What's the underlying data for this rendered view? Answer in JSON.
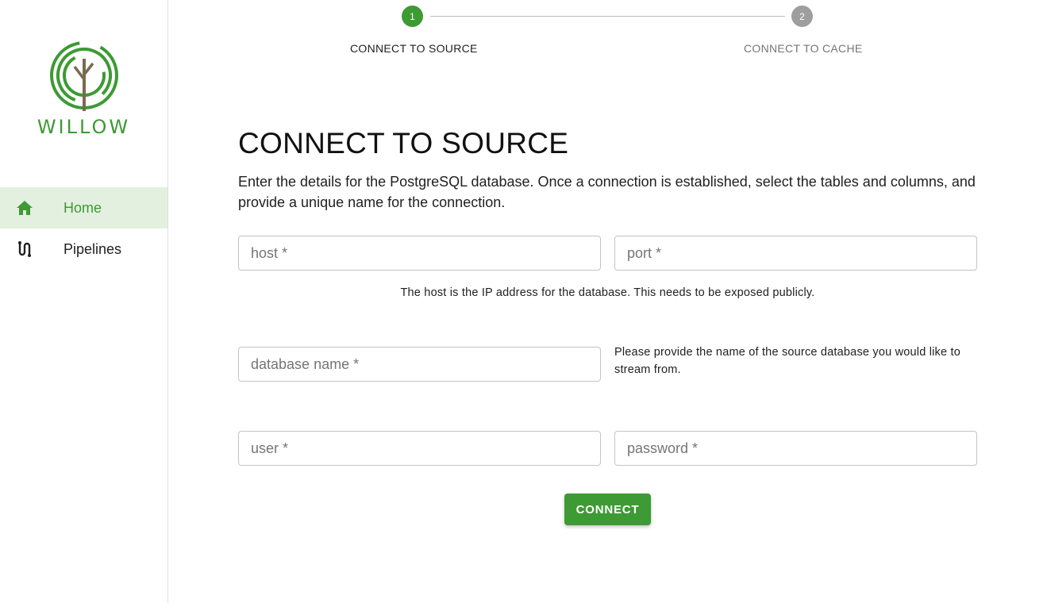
{
  "app": {
    "name": "WILLOW",
    "brand_color": "#3d9a34"
  },
  "sidebar": {
    "items": [
      {
        "label": "Home",
        "icon": "home-icon",
        "active": true
      },
      {
        "label": "Pipelines",
        "icon": "pipeline-icon",
        "active": false
      }
    ]
  },
  "stepper": {
    "steps": [
      {
        "number": "1",
        "label": "CONNECT TO SOURCE",
        "active": true
      },
      {
        "number": "2",
        "label": "CONNECT TO CACHE",
        "active": false
      }
    ]
  },
  "main": {
    "title": "CONNECT TO SOURCE",
    "description": "Enter the details for the PostgreSQL database. Once a connection is established, select the tables and columns, and provide a unique name for the connection.",
    "fields": {
      "host": {
        "placeholder": "host *",
        "value": ""
      },
      "port": {
        "placeholder": "port *",
        "value": ""
      },
      "database_name": {
        "placeholder": "database name *",
        "value": ""
      },
      "user": {
        "placeholder": "user *",
        "value": ""
      },
      "password": {
        "placeholder": "password *",
        "value": ""
      }
    },
    "host_hint": "The host is the IP address for the database. This needs to be exposed publicly.",
    "database_hint": "Please provide the name of the source database you would like to stream from.",
    "connect_label": "CONNECT"
  }
}
